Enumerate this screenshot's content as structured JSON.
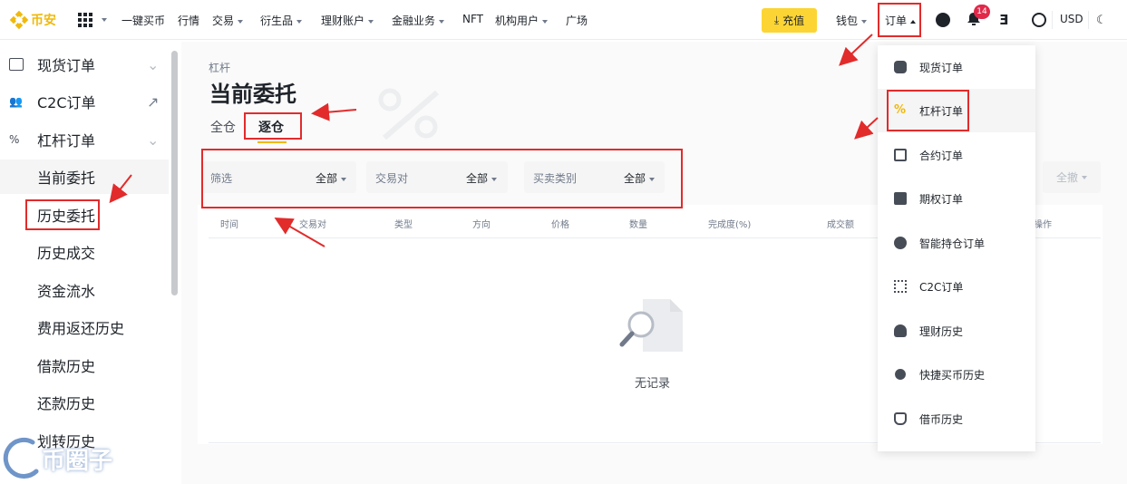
{
  "brand": {
    "name": "币安",
    "color": "#f0b90b"
  },
  "nav": {
    "items": [
      {
        "label": "一键买币",
        "caret": false
      },
      {
        "label": "行情",
        "caret": false
      },
      {
        "label": "交易",
        "caret": true
      },
      {
        "label": "衍生品",
        "caret": true
      },
      {
        "label": "理财账户",
        "caret": true
      },
      {
        "label": "金融业务",
        "caret": true
      },
      {
        "label": "NFT",
        "caret": false
      },
      {
        "label": "机构用户",
        "caret": true
      },
      {
        "label": "广场",
        "caret": false
      }
    ],
    "deposit": "充值",
    "wallet": "钱包",
    "orders": "订单",
    "notification_count": "14",
    "currency": "USD"
  },
  "sidebar": {
    "items": [
      {
        "label": "现货订单",
        "icon": "wallet-icon",
        "trail": "chevron"
      },
      {
        "label": "C2C订单",
        "icon": "people-icon",
        "trail": "external"
      },
      {
        "label": "杠杆订单",
        "icon": "percent-icon",
        "trail": "chevron"
      },
      {
        "label": "当前委托",
        "active": true
      },
      {
        "label": "历史委托"
      },
      {
        "label": "历史成交"
      },
      {
        "label": "资金流水"
      },
      {
        "label": "费用返还历史"
      },
      {
        "label": "借款历史"
      },
      {
        "label": "还款历史"
      },
      {
        "label": "划转历史"
      }
    ]
  },
  "main": {
    "breadcrumb": "杠杆",
    "title": "当前委托",
    "tabs": [
      "全仓",
      "逐仓"
    ],
    "active_tab": "逐仓",
    "filters": [
      {
        "label": "筛选",
        "value": "全部"
      },
      {
        "label": "交易对",
        "value": "全部"
      },
      {
        "label": "买卖类别",
        "value": "全部"
      }
    ],
    "cancel_all": "全撤",
    "columns": [
      "时间",
      "交易对",
      "类型",
      "方向",
      "价格",
      "数量",
      "完成度(%)",
      "成交额",
      "操作"
    ],
    "empty_text": "无记录"
  },
  "dropdown": {
    "items": [
      {
        "label": "现货订单",
        "icon": "spot-order-icon"
      },
      {
        "label": "杠杆订单",
        "icon": "margin-order-icon",
        "active": true
      },
      {
        "label": "合约订单",
        "icon": "futures-order-icon"
      },
      {
        "label": "期权订单",
        "icon": "options-order-icon"
      },
      {
        "label": "智能持仓订单",
        "icon": "smart-position-icon"
      },
      {
        "label": "C2C订单",
        "icon": "c2c-order-icon"
      },
      {
        "label": "理财历史",
        "icon": "earn-history-icon"
      },
      {
        "label": "快捷买币历史",
        "icon": "quick-buy-icon"
      },
      {
        "label": "借币历史",
        "icon": "loan-history-icon"
      }
    ]
  },
  "watermark": {
    "text": "币圈子"
  },
  "colors": {
    "accent": "#f0b90b",
    "annotation": "#e22b2b",
    "badge": "#e0294a"
  }
}
